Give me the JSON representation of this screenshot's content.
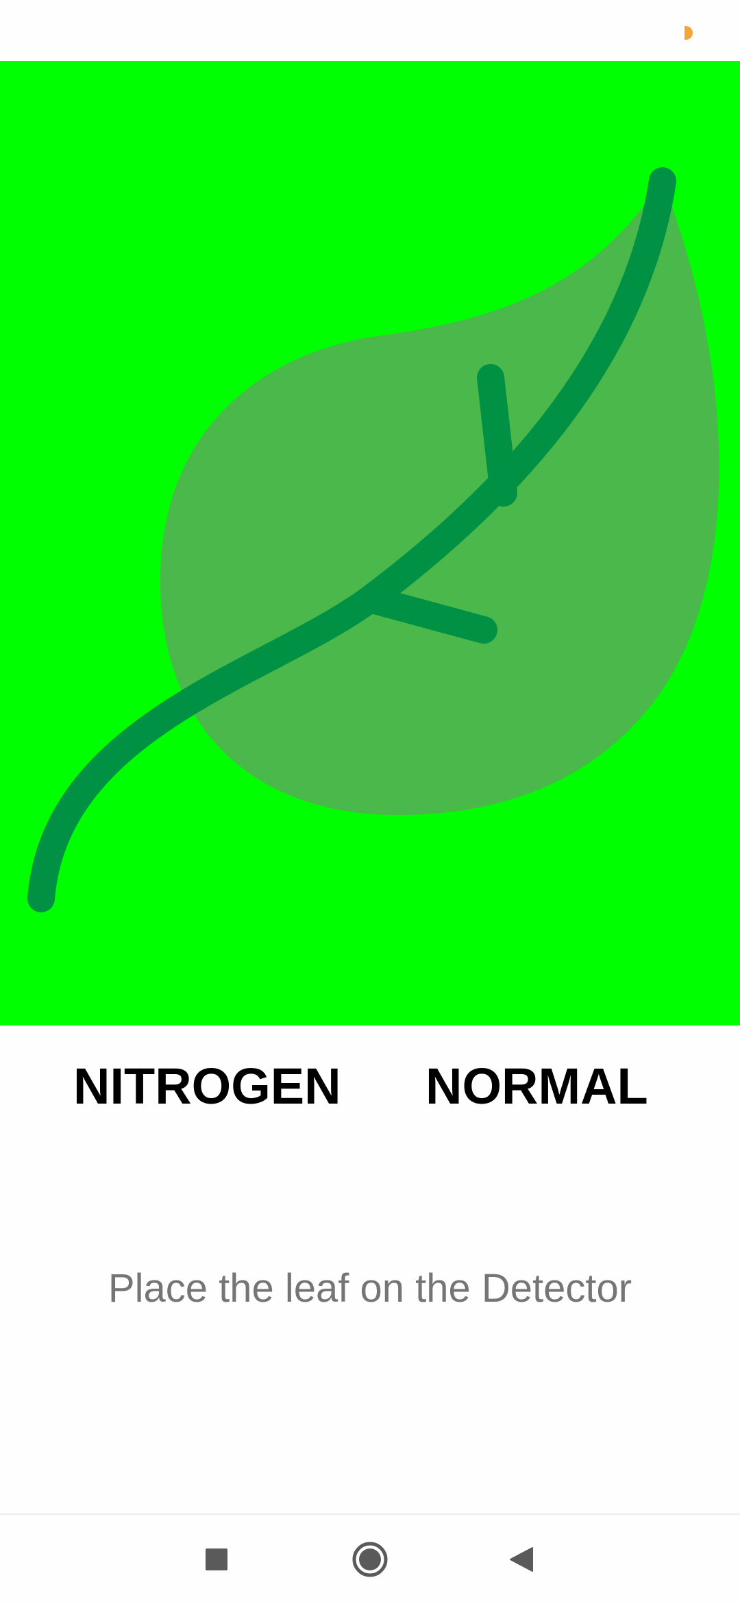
{
  "status_bar": {
    "indicator_color": "#f2a53a"
  },
  "leaf_panel": {
    "background_color": "#00ff00",
    "icon": "leaf-icon",
    "leaf_color": "#4ab84a",
    "vein_color": "#009145"
  },
  "result": {
    "nutrient": "NITROGEN",
    "status": "NORMAL"
  },
  "hint": "Place the leaf on the Detector",
  "nav_bar": {
    "recent_icon": "square-icon",
    "home_icon": "circle-icon",
    "back_icon": "triangle-back-icon"
  }
}
